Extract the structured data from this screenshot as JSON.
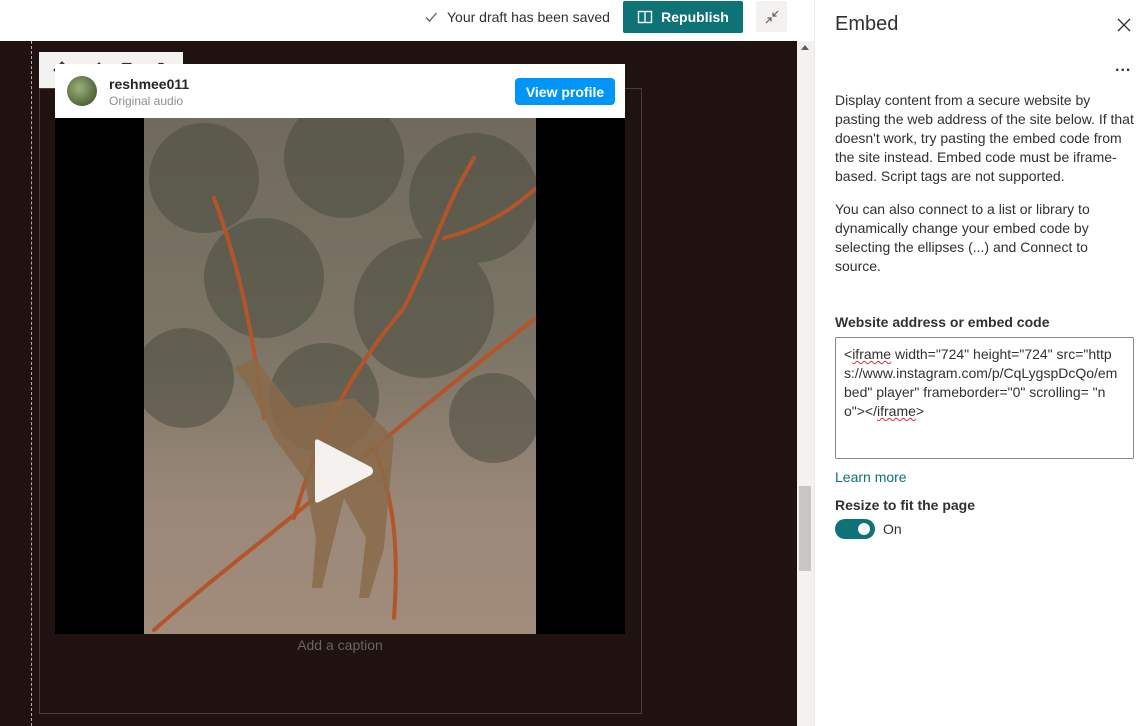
{
  "topbar": {
    "saved_text": "Your draft has been saved",
    "republish_label": "Republish"
  },
  "embed_card": {
    "username": "reshmee011",
    "subtitle": "Original audio",
    "view_profile_label": "View profile",
    "caption_placeholder": "Add a caption"
  },
  "panel": {
    "title": "Embed",
    "more_label": "...",
    "description_1": "Display content from a secure website by pasting the web address of the site below. If that doesn't work, try pasting the embed code from the site instead. Embed code must be iframe-based. Script tags are not supported.",
    "description_2": "You can also connect to a list or library to dynamically change your embed code by selecting the ellipses (...) and Connect to source.",
    "field_label": "Website address or embed code",
    "embed_code": {
      "p1": "<",
      "w1": "iframe",
      "p2": " width=\"724\" height=\"724\" src=\"https://www.instagram.com/p/CqLygspDcQo/embed\" player\" frameborder=\"0\" scrolling= \"no\"></",
      "w2": "iframe",
      "p3": ">"
    },
    "learn_more": "Learn more",
    "resize_label": "Resize to fit the page",
    "toggle_state": "On"
  },
  "colors": {
    "accent": "#0d7377",
    "instagram_blue": "#0095f6",
    "canvas_bg": "#1f1211"
  },
  "icons": [
    "check-icon",
    "book-open-icon",
    "collapse-icon",
    "move-icon",
    "edit-icon",
    "duplicate-icon",
    "delete-icon",
    "play-icon",
    "close-icon"
  ]
}
